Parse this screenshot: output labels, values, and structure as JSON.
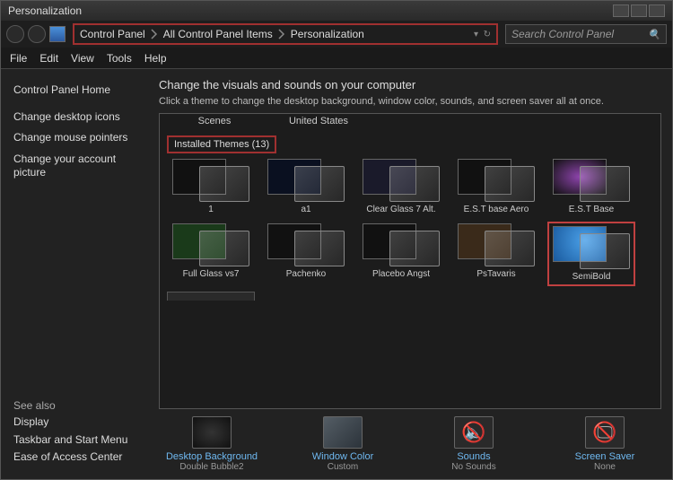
{
  "window_title": "Personalization",
  "breadcrumb": [
    "Control Panel",
    "All Control Panel Items",
    "Personalization"
  ],
  "search_placeholder": "Search Control Panel",
  "menu": [
    "File",
    "Edit",
    "View",
    "Tools",
    "Help"
  ],
  "sidebar": {
    "top": [
      "Control Panel Home",
      "Change desktop icons",
      "Change mouse pointers",
      "Change your account picture"
    ],
    "see_also_label": "See also",
    "bottom": [
      "Display",
      "Taskbar and Start Menu",
      "Ease of Access Center"
    ]
  },
  "main": {
    "heading": "Change the visuals and sounds on your computer",
    "subheading": "Click a theme to change the desktop background, window color, sounds, and screen saver all at once.",
    "partial_top": [
      "Scenes",
      "United States"
    ],
    "section_label": "Installed Themes (13)",
    "themes_row1": [
      "1",
      "a1",
      "Clear Glass 7 Alt.",
      "E.S.T  base Aero",
      "E.S.T Base"
    ],
    "themes_row2": [
      "Full Glass vs7",
      "Pachenko",
      "Placebo Angst",
      "PsTavaris",
      "SemiBold"
    ]
  },
  "actions": {
    "bg": {
      "title": "Desktop Background",
      "sub": "Double Bubble2"
    },
    "wc": {
      "title": "Window Color",
      "sub": "Custom"
    },
    "snd": {
      "title": "Sounds",
      "sub": "No Sounds"
    },
    "ss": {
      "title": "Screen Saver",
      "sub": "None"
    }
  }
}
